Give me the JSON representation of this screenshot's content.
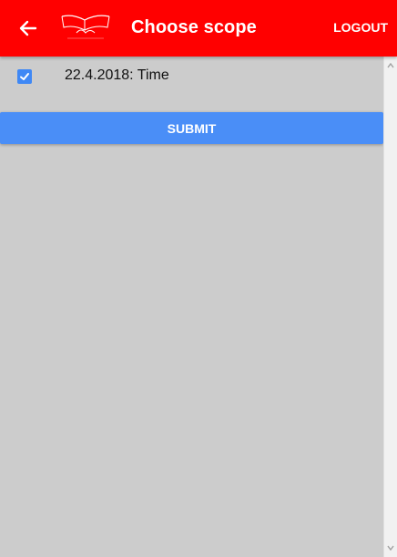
{
  "header": {
    "title": "Choose scope",
    "logout_label": "LOGOUT",
    "background_color": "#ff0000"
  },
  "scopes": [
    {
      "label": "22.4.2018: Time",
      "checked": true
    }
  ],
  "submit_label": "SUBMIT",
  "colors": {
    "checkbox": "#3f88f5",
    "submit": "#4a8ef7",
    "content_bg": "#cccccc"
  },
  "icons": {
    "back": "arrow-left-icon",
    "check": "check-icon",
    "logo": "book-logo-icon"
  }
}
